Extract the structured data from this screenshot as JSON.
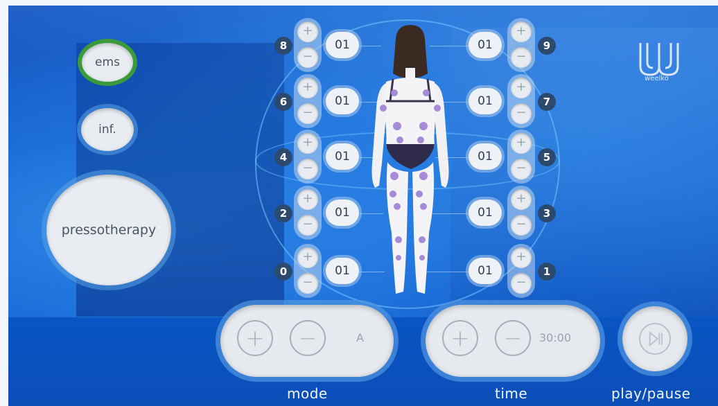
{
  "side_buttons": {
    "ems": "ems",
    "inf": "inf.",
    "pressotherapy": "pressotherapy"
  },
  "channels_left": [
    {
      "id": "8",
      "value": "01"
    },
    {
      "id": "6",
      "value": "01"
    },
    {
      "id": "4",
      "value": "01"
    },
    {
      "id": "2",
      "value": "01"
    },
    {
      "id": "0",
      "value": "01"
    }
  ],
  "channels_right": [
    {
      "id": "9",
      "value": "01"
    },
    {
      "id": "7",
      "value": "01"
    },
    {
      "id": "5",
      "value": "01"
    },
    {
      "id": "3",
      "value": "01"
    },
    {
      "id": "1",
      "value": "01"
    }
  ],
  "mode": {
    "value": "A",
    "label": "mode"
  },
  "time": {
    "value": "30:00",
    "label": "time"
  },
  "play": {
    "label": "play/pause"
  },
  "brand": {
    "name": "weelko"
  },
  "colors": {
    "active_ring": "#3a9a3c",
    "background": "#0c5fd0",
    "button_face": "#e6e9ee",
    "channel_badge": "#2b4a6e"
  },
  "icons": {
    "plus": "plus-icon",
    "minus": "minus-icon",
    "play_pause": "play-pause-icon"
  }
}
